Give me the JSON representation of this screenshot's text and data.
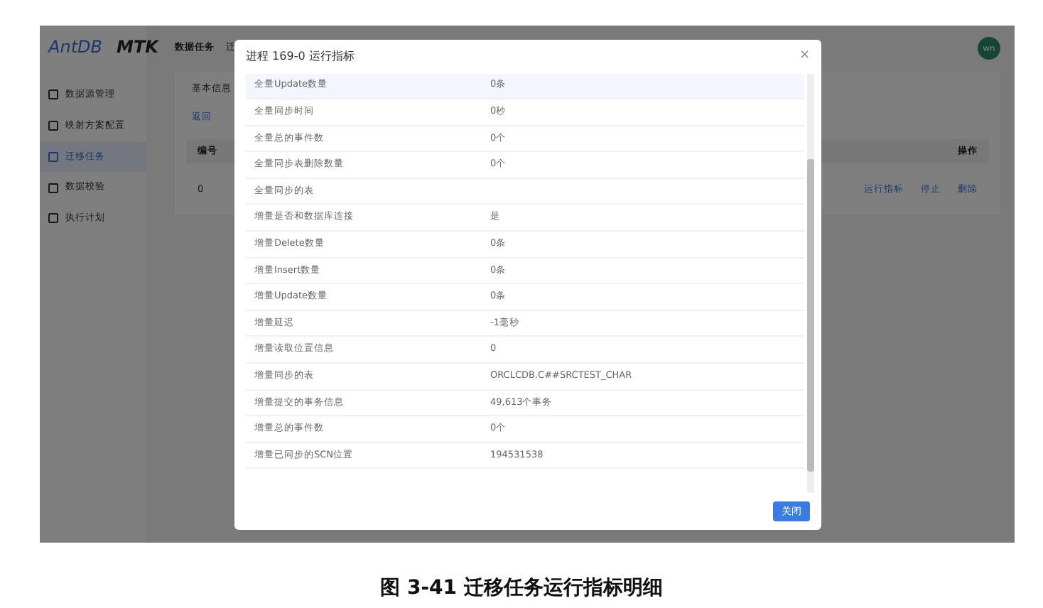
{
  "app": {
    "logo": "AntDB",
    "product": "MTK",
    "avatar": "wn",
    "sidebar": [
      {
        "label": "数据源管理",
        "selected": false
      },
      {
        "label": "映射方案配置",
        "selected": false
      },
      {
        "label": "迁移任务",
        "selected": true
      },
      {
        "label": "数据校验",
        "selected": false
      },
      {
        "label": "执行计划",
        "selected": false
      }
    ],
    "breadcrumb": [
      "数据任务",
      "迁"
    ],
    "tab": "基本信息",
    "link": "返回",
    "table": {
      "columns": [
        "编号",
        "操作"
      ],
      "rows": [
        {
          "cells": [
            "0"
          ],
          "actions": [
            "运行指标",
            "停止",
            "删除"
          ]
        }
      ]
    }
  },
  "dialog": {
    "title": "进程 169-0 运行指标",
    "close": "×",
    "button": "关闭",
    "rows": [
      {
        "label": "全量Update数量",
        "value": "0条",
        "selected": true
      },
      {
        "label": "全量同步时间",
        "value": "0秒",
        "selected": false
      },
      {
        "label": "全量总的事件数",
        "value": "0个",
        "selected": false
      },
      {
        "label": "全量同步表删除数量",
        "value": "0个",
        "selected": false
      },
      {
        "label": "全量同步的表",
        "value": "",
        "selected": false
      },
      {
        "label": "增量是否和数据库连接",
        "value": "是",
        "selected": false
      },
      {
        "label": "增量Delete数量",
        "value": "0条",
        "selected": false
      },
      {
        "label": "增量Insert数量",
        "value": "0条",
        "selected": false
      },
      {
        "label": "增量Update数量",
        "value": "0条",
        "selected": false
      },
      {
        "label": "增量延迟",
        "value": "-1毫秒",
        "selected": false
      },
      {
        "label": "增量读取位置信息",
        "value": "0",
        "selected": false
      },
      {
        "label": "增量同步的表",
        "value": "ORCLCDB.C##SRCTEST_CHAR",
        "selected": false
      },
      {
        "label": "增量提交的事务信息",
        "value": "49,613个事务",
        "selected": false
      },
      {
        "label": "增量总的事件数",
        "value": "0个",
        "selected": false
      },
      {
        "label": "增量已同步的SCN位置",
        "value": "194531538",
        "selected": false
      }
    ]
  },
  "caption": "图 3-41  迁移任务运行指标明细"
}
